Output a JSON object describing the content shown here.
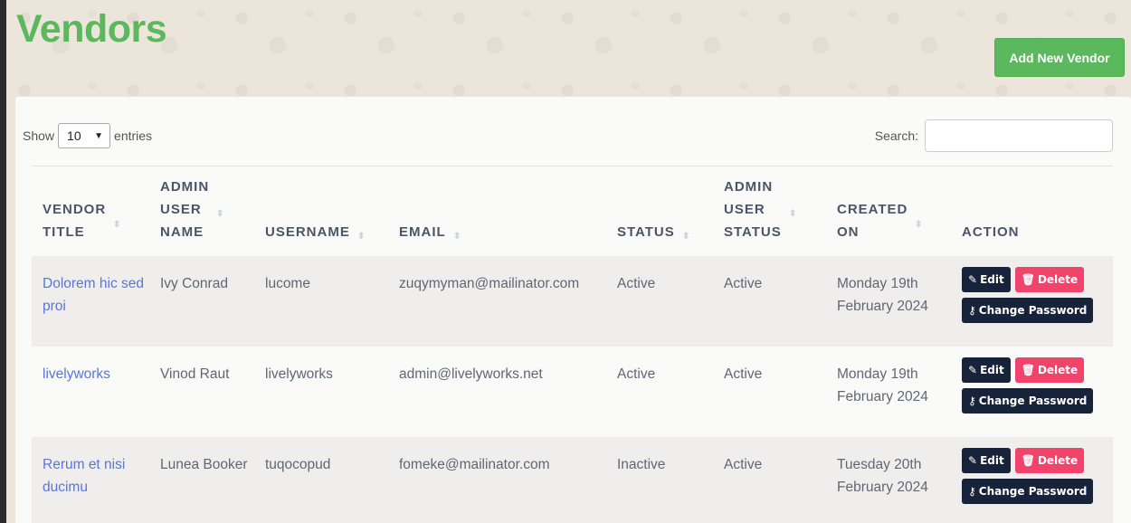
{
  "page": {
    "title": "Vendors",
    "add_button": "Add New Vendor"
  },
  "controls": {
    "show_label": "Show",
    "entries_value": "10",
    "entries_label": "entries",
    "search_label": "Search:",
    "search_value": ""
  },
  "table": {
    "columns": [
      {
        "lines": [
          "VENDOR",
          "TITLE"
        ],
        "sortable": true
      },
      {
        "lines": [
          "ADMIN",
          "USER",
          "NAME"
        ],
        "sortable": true
      },
      {
        "lines": [
          "USERNAME"
        ],
        "sortable": true
      },
      {
        "lines": [
          "EMAIL"
        ],
        "sortable": true
      },
      {
        "lines": [
          "STATUS"
        ],
        "sortable": true
      },
      {
        "lines": [
          "ADMIN",
          "USER",
          "STATUS"
        ],
        "sortable": true
      },
      {
        "lines": [
          "CREATED",
          "ON"
        ],
        "sortable": true
      },
      {
        "lines": [
          "ACTION"
        ],
        "sortable": false
      }
    ],
    "rows": [
      {
        "vendor_title": "Dolorem hic sed proi",
        "admin_user_name": "Ivy Conrad",
        "username": "lucome",
        "email": "zuqymyman@mailinator.com",
        "status": "Active",
        "admin_user_status": "Active",
        "created_on": "Monday 19th February 2024"
      },
      {
        "vendor_title": "livelyworks",
        "admin_user_name": "Vinod Raut",
        "username": "livelyworks",
        "email": "admin@livelyworks.net",
        "status": "Active",
        "admin_user_status": "Active",
        "created_on": "Monday 19th February 2024"
      },
      {
        "vendor_title": "Rerum et nisi ducimu",
        "admin_user_name": "Lunea Booker",
        "username": "tuqocopud",
        "email": "fomeke@mailinator.com",
        "status": "Inactive",
        "admin_user_status": "Active",
        "created_on": "Tuesday 20th February 2024"
      }
    ],
    "actions": {
      "edit": "Edit",
      "delete": "Delete",
      "change_password": "Change Password"
    }
  },
  "colors": {
    "brand_green": "#5cb85c",
    "link": "#5a76d6",
    "dark_button": "#17223b",
    "danger": "#f2436b"
  },
  "icons": {
    "edit": "edit-icon",
    "delete": "trash-icon",
    "change_password": "key-icon",
    "sort": "sort-icon",
    "dropdown": "chevron-down-icon"
  }
}
